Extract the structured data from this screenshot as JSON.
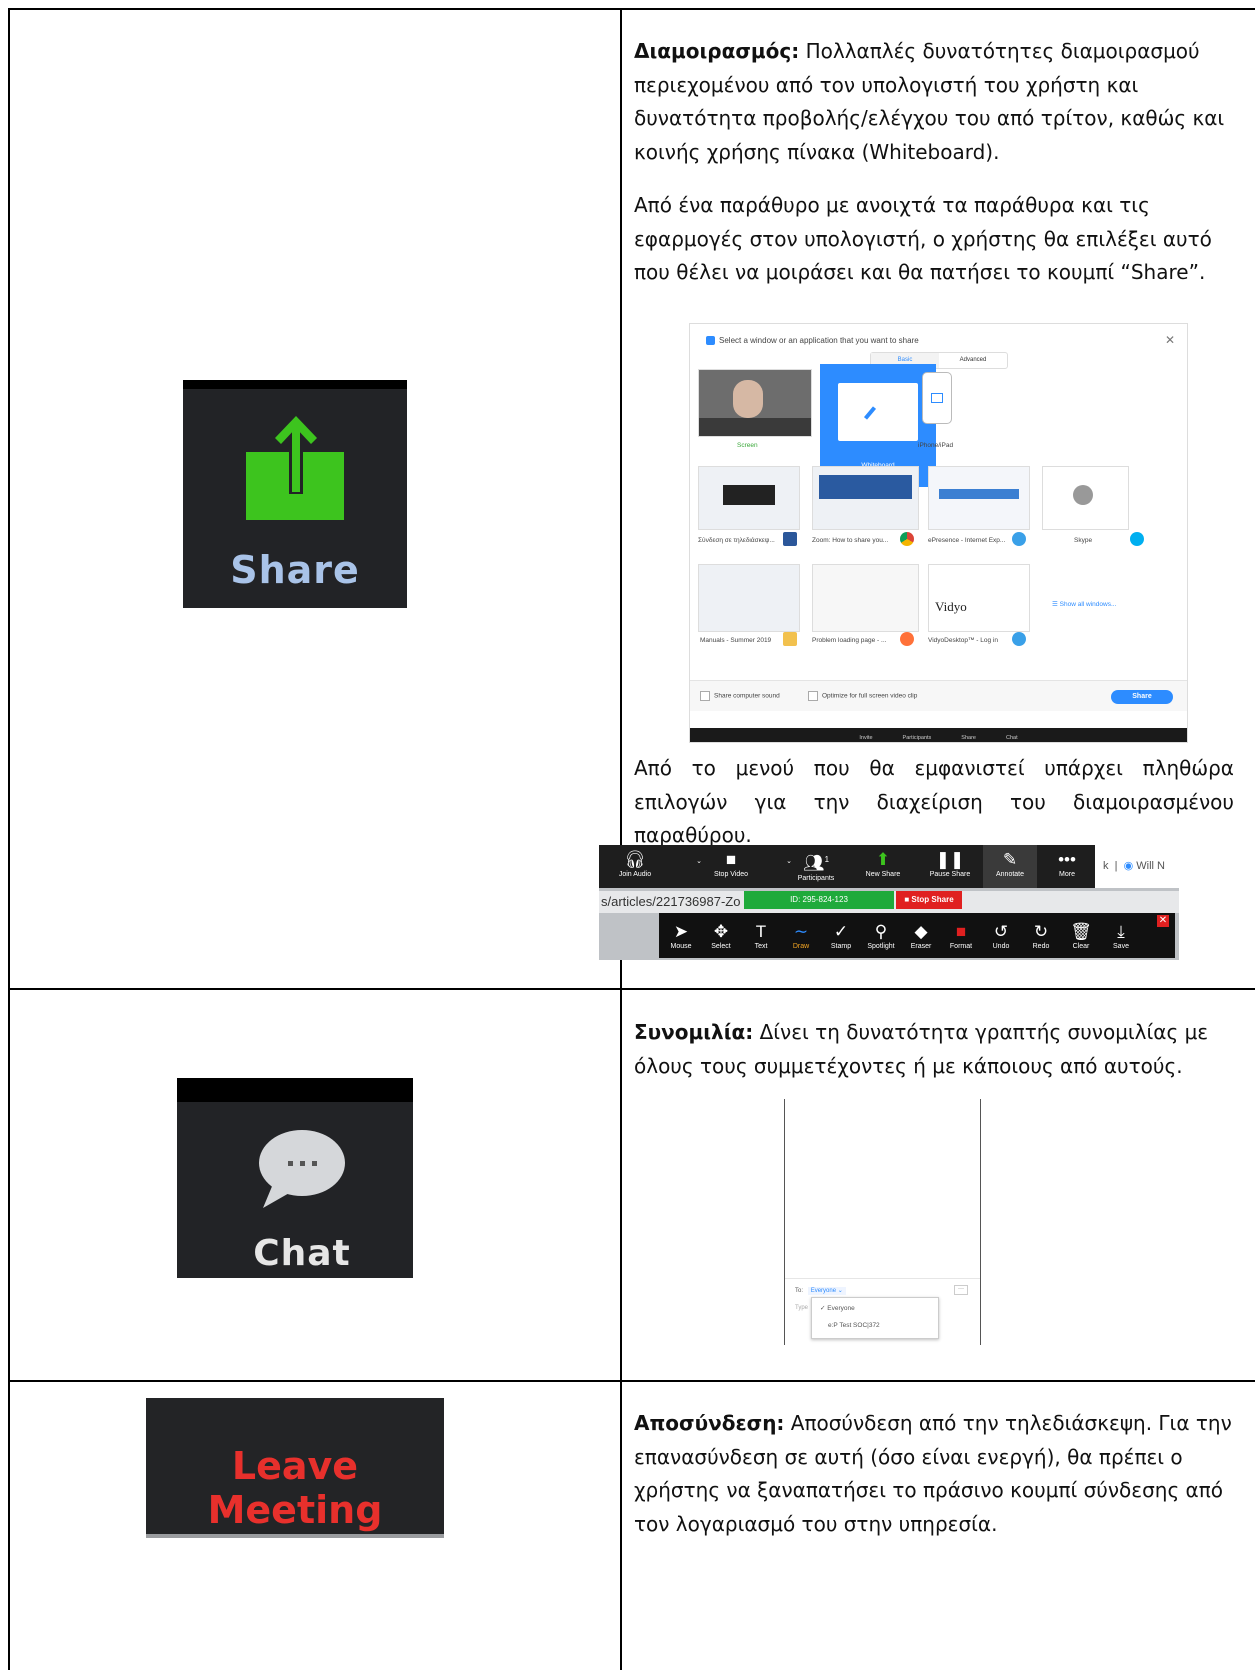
{
  "share": {
    "icon_label": "Share",
    "title": "Διαμοιρασμός:",
    "para1": "Πολλαπλές δυνατότητες διαμοιρασμού περιεχομένου από τον υπολογιστή του χρήστη και δυνατότητα προβολής/ελέγχου του από τρίτον, καθώς και κοινής χρήσης πίνακα (Whiteboard).",
    "para2": "Από ένα παράθυρο με ανοιχτά τα παράθυρα και τις εφαρμογές στον υπολογιστή, ο χρήστης θα επιλέξει αυτό που θέλει να μοιράσει και θα πατήσει το κουμπί “Share”.",
    "para3": "Από το μενού που θα εμφανιστεί υπάρχει πληθώρα επιλογών για την διαχείριση του διαμοιρασμένου παραθύρου."
  },
  "share_dialog": {
    "title": "Select a window or an application that you want to share",
    "tabs": [
      "Basic",
      "Advanced"
    ],
    "tiles": [
      "Screen",
      "Whiteboard",
      "iPhone/iPad",
      "Σύνδεση σε τηλεδιάσκεψ...",
      "Zoom: How to share you...",
      "ePresence - Internet Exp...",
      "Skype",
      "Manuals - Summer 2019",
      "Problem loading page - ...",
      "VidyoDesktop™ - Log in",
      "Show all windows..."
    ],
    "vidyo_logo": "Vidyo",
    "option1": "Share computer sound",
    "option2": "Optimize for full screen video clip",
    "share_button": "Share",
    "bottom_bar": [
      "Invite",
      "Participants",
      "Share",
      "Chat"
    ]
  },
  "toolbar": {
    "top_items": [
      "Join Audio",
      "Stop Video",
      "Participants",
      "New Share",
      "Pause Share",
      "Annotate",
      "More"
    ],
    "participants_count": "1",
    "right_text": "Will N",
    "url": "s/articles/221736987-Zo",
    "meeting_id": "ID: 295-824-123",
    "stop_share": "Stop Share",
    "bottom_items": [
      "Mouse",
      "Select",
      "Text",
      "Draw",
      "Stamp",
      "Spotlight",
      "Eraser",
      "Format",
      "Undo",
      "Redo",
      "Clear",
      "Save"
    ]
  },
  "chat": {
    "icon_label": "Chat",
    "title": "Συνομιλία:",
    "para": "Δίνει τη δυνατότητα γραπτής συνομιλίας με όλους τους συμμετέχοντες ή με κάποιους από αυτούς.",
    "to_label": "To:",
    "to_value": "Everyone ⌄",
    "type_hint": "Type",
    "options": [
      "✓ Everyone",
      "e:P Test SOC|372"
    ]
  },
  "leave": {
    "icon_label": "Leave Meeting",
    "title": "Αποσύνδεση:",
    "para": "Αποσύνδεση από την τηλεδιάσκεψη. Για την επανασύνδεση σε αυτή (όσο είναι ενεργή), θα πρέπει ο χρήστης να ξαναπατήσει το πράσινο κουμπί σύνδεσης από τον λογαριασμό του στην υπηρεσία."
  },
  "colors": {
    "share_green": "#3dc41e",
    "leave_red": "#e8302c",
    "zoom_blue": "#2d8cff",
    "tile_bg": "#222326"
  }
}
